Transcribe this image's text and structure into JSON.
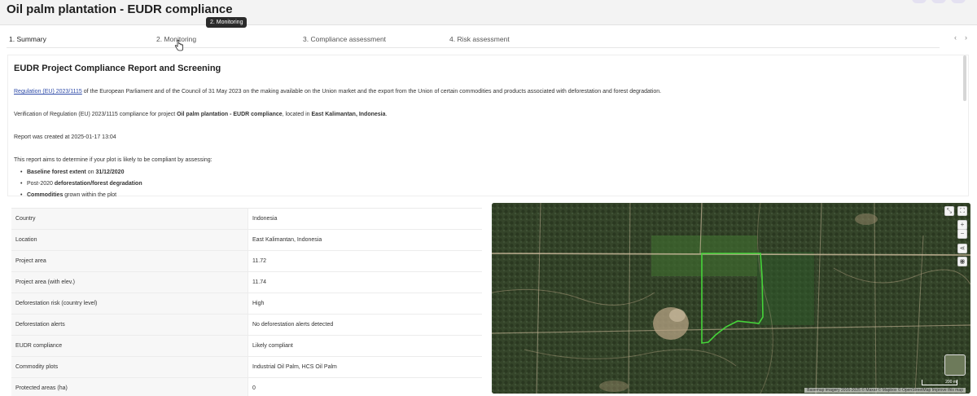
{
  "header": {
    "title": "Oil palm plantation - EUDR compliance"
  },
  "tabs": [
    {
      "label": "1. Summary"
    },
    {
      "label": "2. Monitoring"
    },
    {
      "label": "3. Compliance assessment"
    },
    {
      "label": "4. Risk assessment"
    }
  ],
  "tooltip": "2. Monitoring",
  "tab_nav": {
    "prev": "‹",
    "next": "›"
  },
  "report": {
    "heading": "EUDR Project Compliance Report and Screening",
    "regulation_link": "Regulation (EU) 2023/1115",
    "regulation_text": " of the European Parliament and of the Council of 31 May 2023 on the making available on the Union market and the export from the Union of certain commodities and products associated with deforestation and forest degradation.",
    "verification_prefix": "Verification of Regulation (EU) 2023/1115 compliance for project ",
    "project_name": "Oil palm plantation - EUDR compliance",
    "located_in": ", located in ",
    "location": "East Kalimantan, Indonesia",
    "period": ".",
    "created": "Report was created at 2025-01-17 13:04",
    "aim": "This report aims to determine if your plot is likely to be compliant by assessing:",
    "bullets": [
      {
        "b1": "Baseline forest extent",
        "t1": " on ",
        "b2": "31/12/2020"
      },
      {
        "t0": "Post-2020 ",
        "b1": "deforestation/forest degradation"
      },
      {
        "b1": "Commodities",
        "t1": " grown within the plot"
      }
    ]
  },
  "summary_table": [
    {
      "key": "Country",
      "value": "Indonesia"
    },
    {
      "key": "Location",
      "value": "East Kalimantan, Indonesia"
    },
    {
      "key": "Project area",
      "value": "11.72"
    },
    {
      "key": "Project area (with elev.)",
      "value": "11.74"
    },
    {
      "key": "Deforestation risk (country level)",
      "value": "High"
    },
    {
      "key": "Deforestation alerts",
      "value": "No deforestation alerts detected"
    },
    {
      "key": "EUDR compliance",
      "value": "Likely compliant"
    },
    {
      "key": "Commodity plots",
      "value": "Industrial Oil Palm, HCS Oil Palm"
    },
    {
      "key": "Protected areas (ha)",
      "value": "0"
    }
  ],
  "map": {
    "controls": {
      "zoom_in": "+",
      "zoom_out": "−"
    },
    "scale": "200 m",
    "attribution": "Basemap imagery 2016-2025 © Maxar © Mapbox © OpenStreetMap Improve this map",
    "polygon_color": "#46d43a"
  }
}
